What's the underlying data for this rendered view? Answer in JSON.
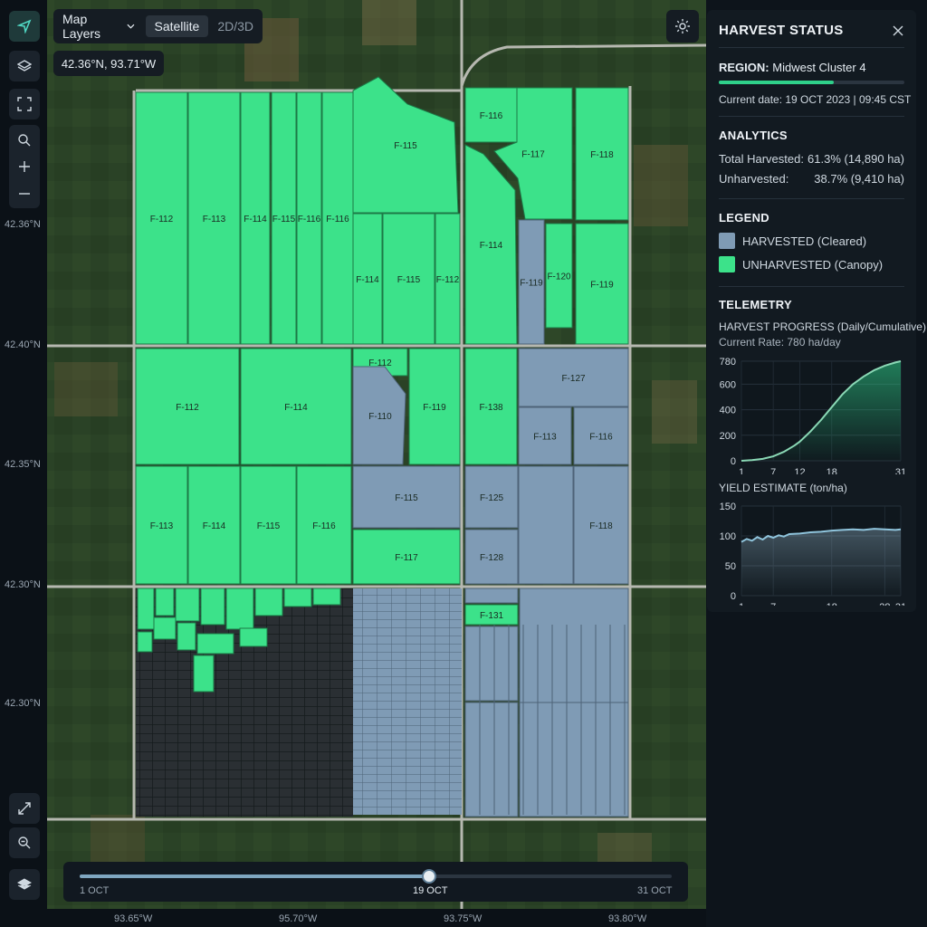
{
  "toolbar": {
    "map_layers_label": "Map Layers",
    "satellite_label": "Satellite",
    "view_mode_label": "2D/3D",
    "coordinate_readout": "42.36°N, 93.71°W"
  },
  "panel": {
    "title": "HARVEST STATUS",
    "region_label": "REGION:",
    "region_value": "Midwest Cluster 4",
    "region_progress": 0.62,
    "current_date": "Current date: 19 OCT 2023 | 09:45 CST",
    "analytics_heading": "ANALYTICS",
    "harvested_label": "Total Harvested:",
    "harvested_value": "61.3% (14,890 ha)",
    "unharvested_label": "Unharvested:",
    "unharvested_value": "38.7% (9,410 ha)",
    "legend_heading": "LEGEND",
    "legend_harvested": "HARVESTED (Cleared)",
    "legend_unharvested": "UNHARVESTED (Canopy)",
    "telemetry_heading": "TELEMETRY",
    "progress_title": "HARVEST PROGRESS (Daily/Cumulative)",
    "current_rate": "Current Rate: 780 ha/day",
    "yield_title": "YIELD ESTIMATE (ton/ha)"
  },
  "colors": {
    "harvested": "#7f9bb5",
    "unharvested": "#3ce28a",
    "accent": "#2fd08a"
  },
  "timeline": {
    "start_label": "1 OCT",
    "current_label": "19 OCT",
    "end_label": "31 OCT",
    "progress": 0.59
  },
  "map_axes": {
    "lat_labels": [
      "42.36°N",
      "42.40°N",
      "42.35°N",
      "42.30°N",
      "42.30°N"
    ],
    "lon_labels": [
      "93.65°W",
      "95.70°W",
      "93.75°W",
      "93.80°W"
    ]
  },
  "fields": [
    {
      "id": "F-112",
      "status": "unharvested"
    },
    {
      "id": "F-113",
      "status": "unharvested"
    },
    {
      "id": "F-114",
      "status": "unharvested"
    },
    {
      "id": "F-115",
      "status": "unharvested"
    },
    {
      "id": "F-116",
      "status": "unharvested"
    },
    {
      "id": "F-116",
      "status": "unharvested"
    },
    {
      "id": "F-115",
      "status": "unharvested"
    },
    {
      "id": "F-114",
      "status": "unharvested"
    },
    {
      "id": "F-115",
      "status": "unharvested"
    },
    {
      "id": "F-112",
      "status": "unharvested"
    },
    {
      "id": "F-116",
      "status": "unharvested"
    },
    {
      "id": "F-117",
      "status": "unharvested"
    },
    {
      "id": "F-118",
      "status": "unharvested"
    },
    {
      "id": "F-114",
      "status": "unharvested"
    },
    {
      "id": "F-119",
      "status": "harvested"
    },
    {
      "id": "F-120",
      "status": "unharvested"
    },
    {
      "id": "F-119",
      "status": "unharvested"
    },
    {
      "id": "F-112",
      "status": "unharvested"
    },
    {
      "id": "F-114",
      "status": "unharvested"
    },
    {
      "id": "F-112",
      "status": "unharvested"
    },
    {
      "id": "F-110",
      "status": "harvested"
    },
    {
      "id": "F-119",
      "status": "unharvested"
    },
    {
      "id": "F-138",
      "status": "unharvested"
    },
    {
      "id": "F-127",
      "status": "harvested"
    },
    {
      "id": "F-113",
      "status": "harvested"
    },
    {
      "id": "F-116",
      "status": "harvested"
    },
    {
      "id": "F-113",
      "status": "unharvested"
    },
    {
      "id": "F-114",
      "status": "unharvested"
    },
    {
      "id": "F-115",
      "status": "unharvested"
    },
    {
      "id": "F-116",
      "status": "unharvested"
    },
    {
      "id": "F-115",
      "status": "harvested"
    },
    {
      "id": "F-117",
      "status": "unharvested"
    },
    {
      "id": "F-125",
      "status": "harvested"
    },
    {
      "id": "F-128",
      "status": "harvested"
    },
    {
      "id": "F-118",
      "status": "harvested"
    },
    {
      "id": "F-131",
      "status": "unharvested"
    }
  ],
  "chart_data": [
    {
      "type": "area",
      "title": "HARVEST PROGRESS (Daily/Cumulative)",
      "subtitle": "Current Rate: 780 ha/day",
      "x_ticks": [
        1,
        7,
        12,
        18,
        31
      ],
      "y_ticks": [
        0,
        200,
        400,
        600,
        780
      ],
      "ylim": [
        0,
        780
      ],
      "x": [
        1,
        3,
        5,
        7,
        9,
        11,
        12,
        14,
        16,
        18,
        20,
        22,
        24,
        26,
        28,
        30,
        31
      ],
      "values": [
        0,
        5,
        15,
        35,
        70,
        120,
        150,
        230,
        320,
        420,
        520,
        600,
        660,
        710,
        745,
        770,
        780
      ]
    },
    {
      "type": "area",
      "title": "YIELD ESTIMATE (ton/ha)",
      "x_ticks": [
        1,
        7,
        18,
        28,
        31
      ],
      "y_ticks": [
        0,
        50,
        100,
        150
      ],
      "ylim": [
        0,
        150
      ],
      "x": [
        1,
        2,
        3,
        4,
        5,
        6,
        7,
        8,
        9,
        10,
        12,
        14,
        16,
        18,
        20,
        22,
        24,
        26,
        28,
        30,
        31
      ],
      "values": [
        90,
        95,
        92,
        98,
        94,
        100,
        97,
        101,
        99,
        103,
        104,
        106,
        107,
        109,
        110,
        111,
        110,
        112,
        111,
        110,
        111
      ]
    }
  ]
}
